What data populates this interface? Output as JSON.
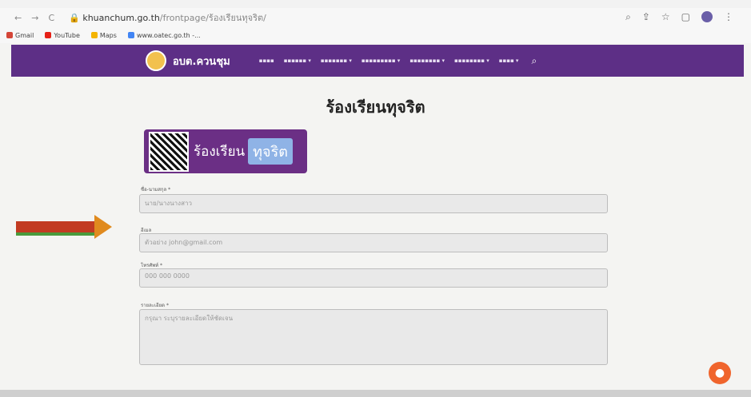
{
  "browser": {
    "url_domain": "khuanchum.go.th",
    "url_path": "/frontpage/ร้องเรียนทุจริต/",
    "bookmarks": [
      "Gmail",
      "YouTube",
      "Maps",
      "www.oatec.go.th -..."
    ]
  },
  "site": {
    "name": "อบต.ควนชุม"
  },
  "page": {
    "title": "ร้องเรียนทุจริต",
    "banner_left": "ร้องเรียน",
    "banner_chip": "ทุจริต"
  },
  "form": {
    "name_label": "ชื่อ-นามสกุล *",
    "name_placeholder": "นาย/นางนางสาว",
    "email_label": "อีเมล",
    "email_placeholder": "ตัวอย่าง john@gmail.com",
    "phone_label": "โทรศัพท์ *",
    "phone_placeholder": "000 000 0000",
    "detail_label": "รายละเอียด *",
    "detail_placeholder": "กรุณา ระบุรายละเอียดให้ชัดเจน"
  },
  "icons": {
    "chat": "chat-icon"
  }
}
